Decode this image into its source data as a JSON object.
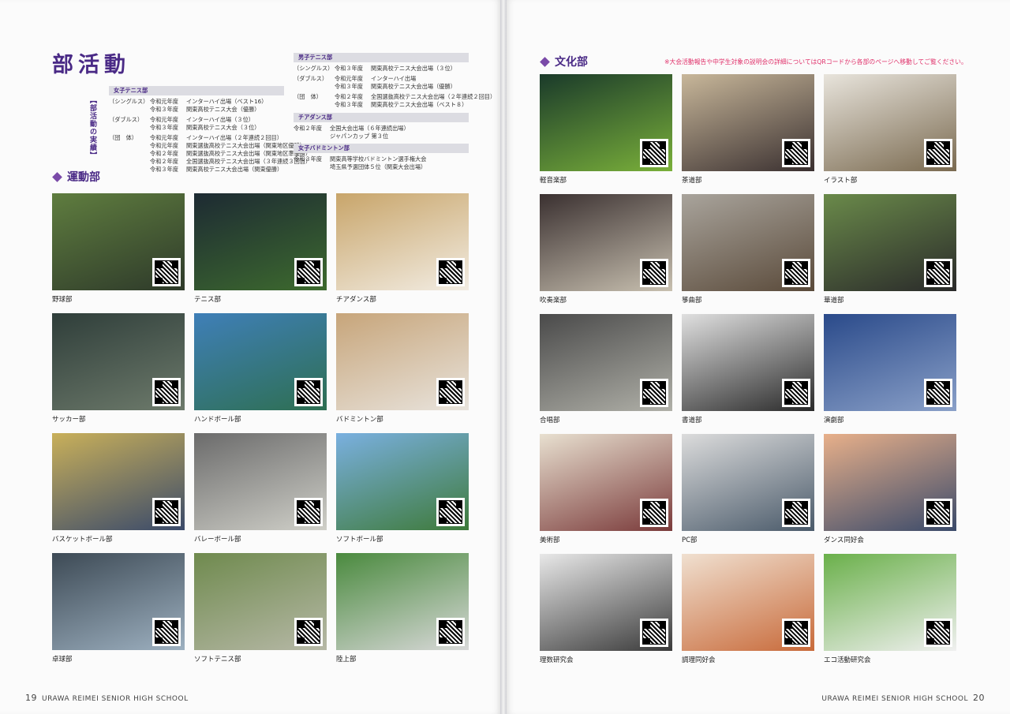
{
  "title": "部活動",
  "results_label": "【部活動の実績】",
  "results": {
    "womens_tennis": {
      "head": "女子テニス部",
      "rows": [
        {
          "cat": "（シングルス）",
          "year": "令和元年度",
          "text": "インターハイ出場（ベスト16）"
        },
        {
          "cat": "",
          "year": "令和３年度",
          "text": "関東高校テニス大会（優勝）"
        },
        {
          "cat": "（ダブルス）",
          "year": "令和元年度",
          "text": "インターハイ出場（３位）"
        },
        {
          "cat": "",
          "year": "令和３年度",
          "text": "関東高校テニス大会（３位）"
        },
        {
          "cat": "（団　体）",
          "year": "令和元年度",
          "text": "インターハイ出場（２年連続２回目）"
        },
        {
          "cat": "",
          "year": "令和元年度",
          "text": "関東選抜高校テニス大会出場（関東地区優勝）"
        },
        {
          "cat": "",
          "year": "令和２年度",
          "text": "関東選抜高校テニス大会出場（関東地区準優勝）"
        },
        {
          "cat": "",
          "year": "令和２年度",
          "text": "全国選抜高校テニス大会出場（３年連続３回目）"
        },
        {
          "cat": "",
          "year": "令和３年度",
          "text": "関東高校テニス大会出場（関東優勝）"
        }
      ]
    },
    "mens_tennis": {
      "head": "男子テニス部",
      "rows": [
        {
          "cat": "（シングルス）",
          "year": "令和３年度",
          "text": "関東高校テニス大会出場（３位）"
        },
        {
          "cat": "（ダブルス）",
          "year": "令和元年度",
          "text": "インターハイ出場"
        },
        {
          "cat": "",
          "year": "令和３年度",
          "text": "関東高校テニス大会出場（優勝）"
        },
        {
          "cat": "（団　体）",
          "year": "令和２年度",
          "text": "全国選抜高校テニス大会出場（２年連続２回目）"
        },
        {
          "cat": "",
          "year": "令和３年度",
          "text": "関東高校テニス大会出場（ベスト８）"
        }
      ]
    },
    "cheer_dance": {
      "head": "チアダンス部",
      "rows": [
        {
          "year": "令和２年度",
          "text": "全国大会出場（６年連続出場）"
        },
        {
          "year": "",
          "text": "ジャパンカップ 第３位"
        }
      ]
    },
    "womens_badminton": {
      "head": "女子バドミントン部",
      "rows": [
        {
          "year": "令和３年度",
          "text": "関東高等学校バドミントン選手権大会"
        },
        {
          "year": "",
          "text": "埼玉県予選団体５位（関東大会出場）"
        }
      ]
    }
  },
  "sports_heading": "運動部",
  "culture_heading": "文化部",
  "notice": "※大会活動報告や中学生対象の説明会の詳細についてはQRコードから各部のページへ移動してご覧ください。",
  "sports_clubs": [
    {
      "label": "野球部",
      "qr": "硬式野球部"
    },
    {
      "label": "テニス部",
      "qr": "テニス部"
    },
    {
      "label": "チアダンス部",
      "qr": "チアダンス部"
    },
    {
      "label": "サッカー部",
      "qr": "サッカー部"
    },
    {
      "label": "ハンドボール部",
      "qr": "ハンドボール部"
    },
    {
      "label": "バドミントン部",
      "qr": "バドミントン部"
    },
    {
      "label": "バスケットボール部",
      "qr": "バスケットボール部"
    },
    {
      "label": "バレーボール部",
      "qr": "バレーボール部"
    },
    {
      "label": "ソフトボール部",
      "qr": "ソフトボール部"
    },
    {
      "label": "卓球部",
      "qr": "卓球部"
    },
    {
      "label": "ソフトテニス部",
      "qr": "ソフトテニス部"
    },
    {
      "label": "陸上部",
      "qr": "陸上部"
    }
  ],
  "culture_clubs": [
    {
      "label": "軽音楽部",
      "qr": "軽音楽部"
    },
    {
      "label": "茶道部",
      "qr": "茶道部"
    },
    {
      "label": "イラスト部",
      "qr": "イラスト部"
    },
    {
      "label": "吹奏楽部",
      "qr": "吹奏楽部"
    },
    {
      "label": "箏曲部",
      "qr": "箏曲部"
    },
    {
      "label": "華道部",
      "qr": "華道部"
    },
    {
      "label": "合唱部",
      "qr": "合唱部"
    },
    {
      "label": "書道部",
      "qr": "書道部"
    },
    {
      "label": "演劇部",
      "qr": "演劇部"
    },
    {
      "label": "美術部",
      "qr": "美術部"
    },
    {
      "label": "PC部",
      "qr": "PC部"
    },
    {
      "label": "ダンス同好会",
      "qr": "ダンス同好会"
    },
    {
      "label": "理数研究会",
      "qr": "理数研究会"
    },
    {
      "label": "調理同好会",
      "qr": "調理同好会"
    },
    {
      "label": "エコ活動研究会",
      "qr": "ECO"
    }
  ],
  "footer_left": {
    "page": "19",
    "school": "URAWA REIMEI SENIOR HIGH SCHOOL"
  },
  "footer_right": {
    "page": "20",
    "school": "URAWA REIMEI SENIOR HIGH SCHOOL"
  },
  "colors": {
    "accent": "#4a2a86",
    "notice": "#e0306a"
  }
}
